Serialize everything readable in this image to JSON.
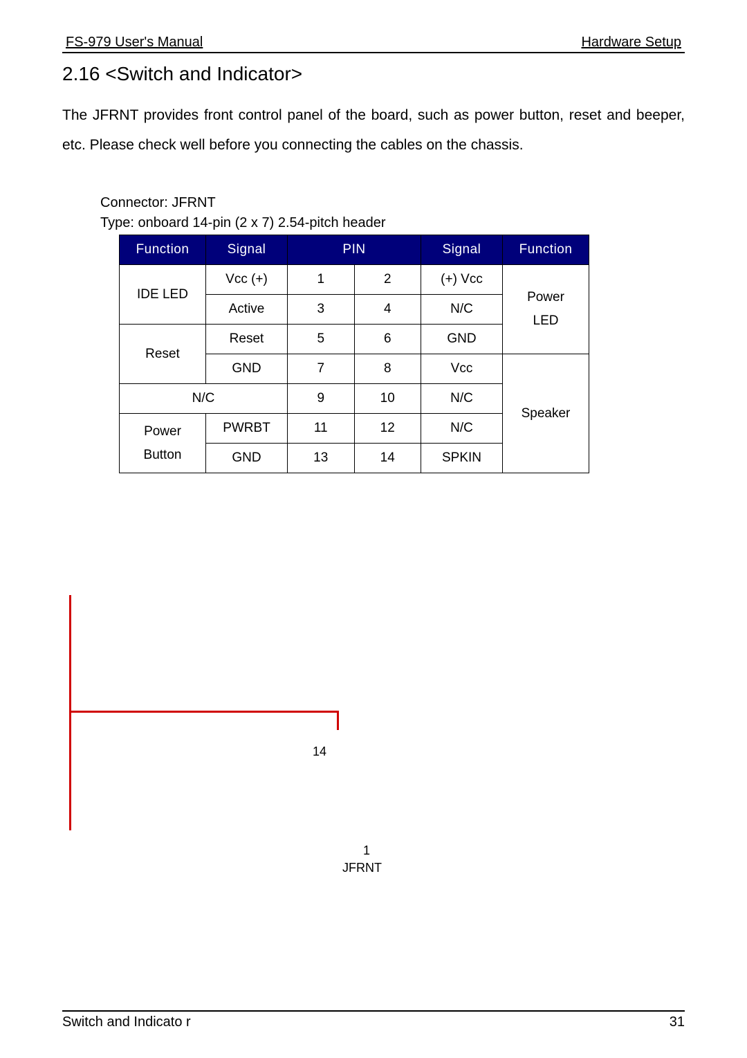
{
  "header": {
    "left": " FS-979 User's Manual",
    "right": "Hardware Setup"
  },
  "section": {
    "title": "2.16 <Switch and Indicator>",
    "intro": "The JFRNT provides front control panel of the board, such as power button, reset and beeper, etc. Please check well before you connecting the cables on the chassis."
  },
  "connector": {
    "name": "Connector: JFRNT",
    "type": "Type: onboard 14-pin (2 x 7) 2.54-pitch header"
  },
  "table": {
    "headers": {
      "func_l": "Function",
      "sig_l": "Signal",
      "pin": "PIN",
      "sig_r": "Signal",
      "func_r": "Function"
    },
    "func_left": {
      "ide_led": "IDE LED",
      "reset": "Reset",
      "nc_blank": "",
      "power_button_l1": "Power",
      "power_button_l2": "Button"
    },
    "func_right": {
      "power_led_l1": "Power",
      "power_led_l2": "LED",
      "speaker": "Speaker"
    },
    "rows": [
      {
        "sig_l": "Vcc  (+)",
        "p1": "1",
        "p2": "2",
        "sig_r": "(+) Vcc"
      },
      {
        "sig_l": "Active",
        "p1": "3",
        "p2": "4",
        "sig_r": "N/C"
      },
      {
        "sig_l": "Reset",
        "p1": "5",
        "p2": "6",
        "sig_r": "GND"
      },
      {
        "sig_l": "GND",
        "p1": "7",
        "p2": "8",
        "sig_r": "Vcc"
      },
      {
        "sig_l": "N/C",
        "p1": "9",
        "p2": "10",
        "sig_r": "N/C"
      },
      {
        "sig_l": "PWRBT",
        "p1": "11",
        "p2": "12",
        "sig_r": "N/C"
      },
      {
        "sig_l": "GND",
        "p1": "13",
        "p2": "14",
        "sig_r": "SPKIN"
      }
    ]
  },
  "diagram": {
    "pin14": "14",
    "pin1": "1",
    "label": "JFRNT"
  },
  "footer": {
    "left": "Switch and Indicato r",
    "right": "31"
  }
}
